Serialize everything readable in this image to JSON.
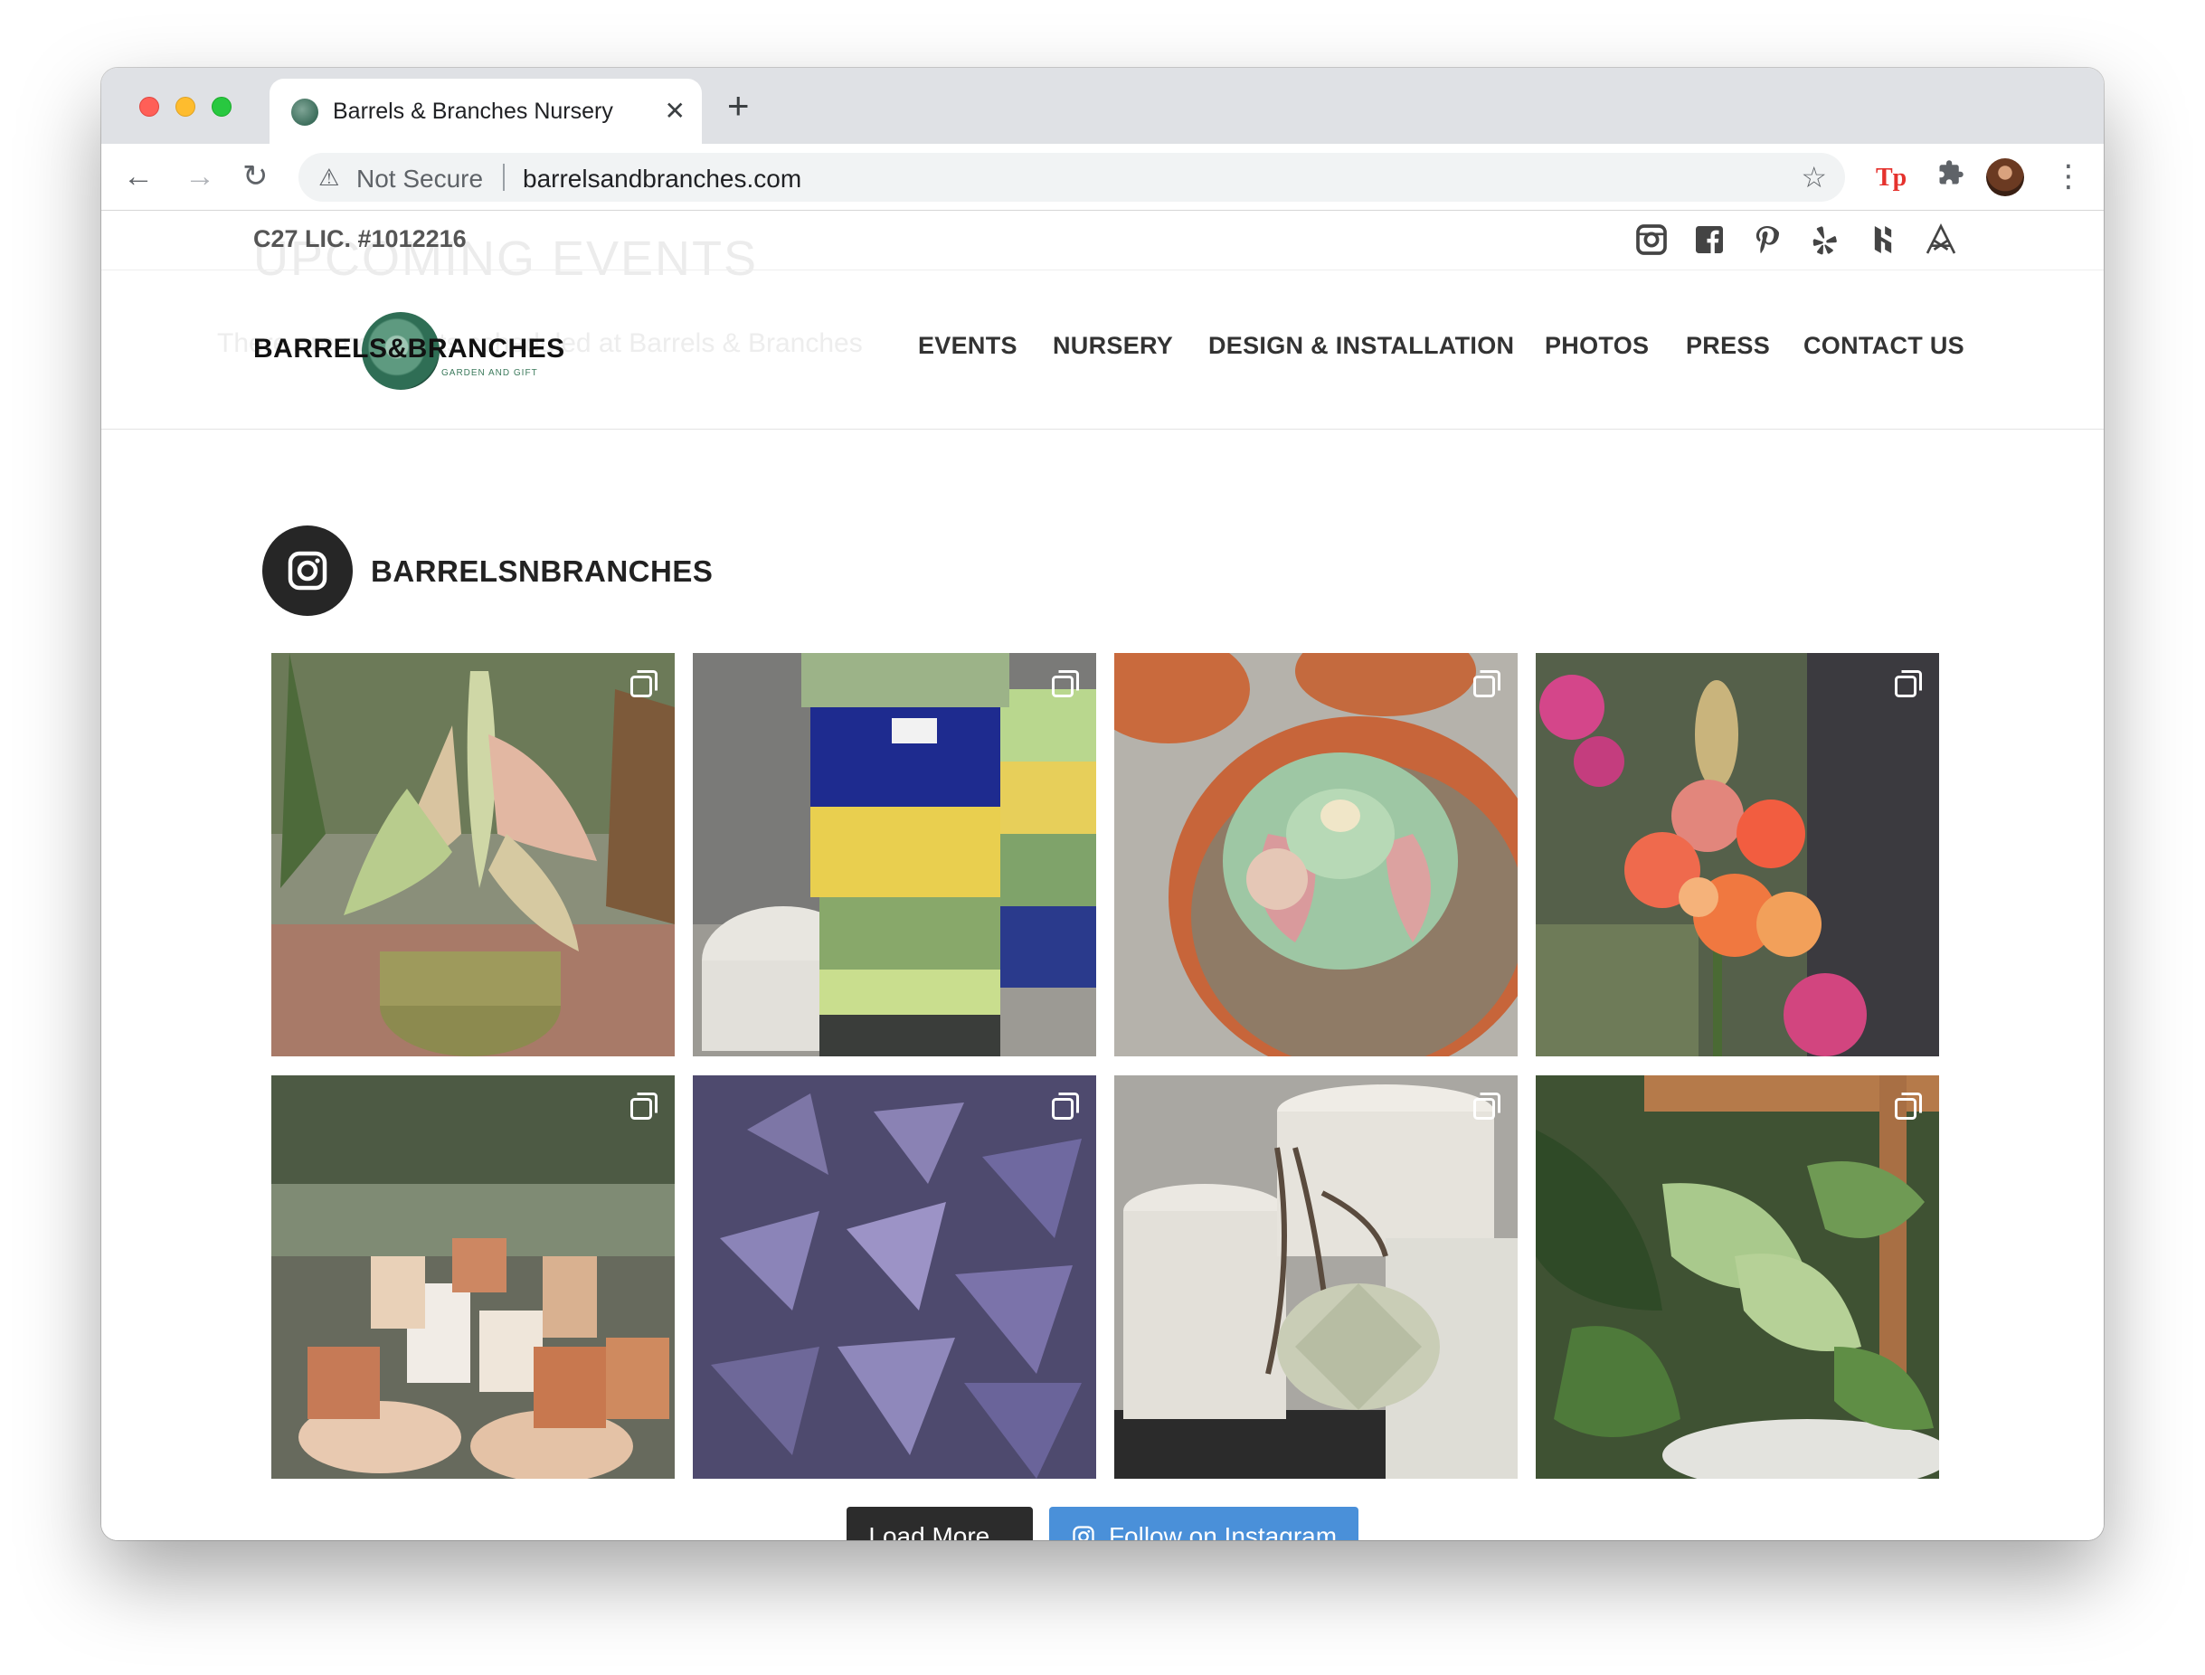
{
  "browser": {
    "tab_title": "Barrels & Branches Nursery",
    "tab_close": "✕",
    "new_tab": "+",
    "security_label": "Not Secure",
    "url": "barrelsandbranches.com",
    "extension_label": "Tp"
  },
  "site": {
    "license": "C27 LIC. #1012216",
    "ghost_heading": "UPCOMING EVENTS",
    "ghost_text": "There are no events scheduled at Barrels & Branches",
    "logo": {
      "text": "BARRELS&BRANCHES",
      "subtitle": "GARDEN AND GIFT"
    },
    "nav": {
      "events": "EVENTS",
      "nursery": "NURSERY",
      "design": "DESIGN & INSTALLATION",
      "photos": "PHOTOS",
      "press": "PRESS",
      "contact": "CONTACT US"
    },
    "social_icons": [
      "instagram-icon",
      "facebook-icon",
      "pinterest-icon",
      "yelp-icon",
      "houzz-icon",
      "nextdoor-icon"
    ]
  },
  "instagram_feed": {
    "username": "BARRELSNBRANCHES",
    "photos": [
      {
        "subject": "variegated houseplant in pot"
      },
      {
        "subject": "stacked glazed pots"
      },
      {
        "subject": "succulent in terracotta pot"
      },
      {
        "subject": "snapdragon flowers"
      },
      {
        "subject": "terracotta pots"
      },
      {
        "subject": "purple oxalis leaves"
      },
      {
        "subject": "air plant with white pots"
      },
      {
        "subject": "philodendron plants"
      }
    ],
    "load_more_label": "Load More...",
    "follow_label": "Follow on Instagram"
  },
  "colors": {
    "follow_button": "#4a90d9",
    "load_button": "#2c2c2c",
    "brand_green": "#3c7a5c"
  }
}
